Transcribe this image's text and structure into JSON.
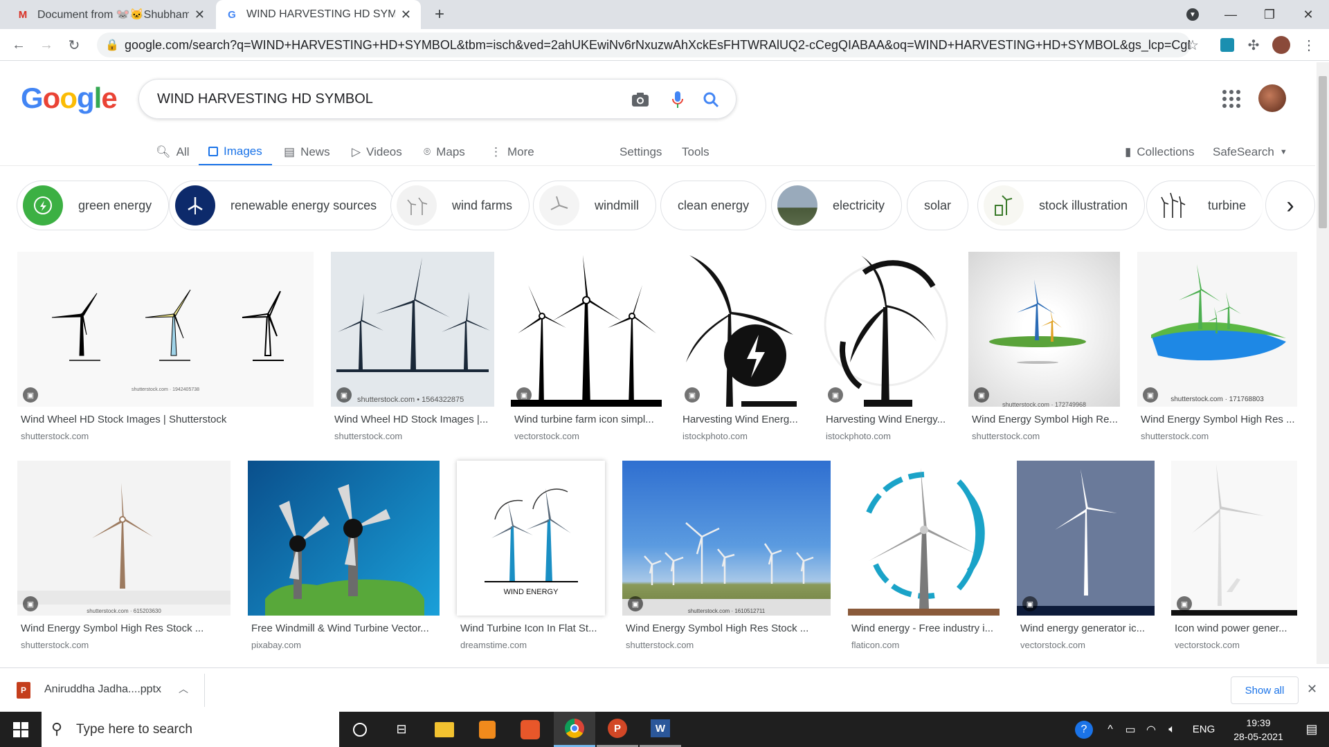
{
  "browser": {
    "tabs": [
      {
        "favicon": "gmail-icon",
        "title": "Document from 🐭🐱Shubham🧍"
      },
      {
        "favicon": "google-icon",
        "title": "WIND HARVESTING HD SYMBOL"
      }
    ],
    "url": "google.com/search?q=WIND+HARVESTING+HD+SYMBOL&tbm=isch&ved=2ahUKEwiNv6rNxuzwAhXckEsFHTWRAlUQ2-cCegQIABAA&oq=WIND+HARVESTING+HD+SYMBOL&gs_lcp=CgNpbW..."
  },
  "google": {
    "logo": "Google",
    "query": "WIND HARVESTING HD SYMBOL",
    "tabs": [
      "All",
      "Images",
      "News",
      "Videos",
      "Maps",
      "More"
    ],
    "settings": "Settings",
    "tools": "Tools",
    "collections": "Collections",
    "safesearch": "SafeSearch"
  },
  "chips": [
    "green energy",
    "renewable energy sources",
    "wind farms",
    "windmill",
    "clean energy",
    "electricity",
    "solar",
    "stock illustration",
    "turbine"
  ],
  "results": [
    {
      "caption": "Wind Wheel HD Stock Images | Shutterstock",
      "source": "shutterstock.com",
      "watermark": "shutterstock.com · 1942405738"
    },
    {
      "caption": "Wind Wheel HD Stock Images |...",
      "source": "shutterstock.com",
      "watermark": "shutterstock.com • 1564322875"
    },
    {
      "caption": "Wind turbine farm icon simpl...",
      "source": "vectorstock.com",
      "watermark": ""
    },
    {
      "caption": "Harvesting Wind Energ...",
      "source": "istockphoto.com",
      "watermark": ""
    },
    {
      "caption": "Harvesting Wind Energy...",
      "source": "istockphoto.com",
      "watermark": ""
    },
    {
      "caption": "Wind Energy Symbol High Re...",
      "source": "shutterstock.com",
      "watermark": "shutterstock.com · 172749968"
    },
    {
      "caption": "Wind Energy Symbol High Res ...",
      "source": "shutterstock.com",
      "watermark": "shutterstock.com · 171768803"
    },
    {
      "caption": "Wind Energy Symbol High Res Stock ...",
      "source": "shutterstock.com",
      "watermark": "shutterstock.com · 615203630"
    },
    {
      "caption": "Free Windmill & Wind Turbine Vector...",
      "source": "pixabay.com",
      "watermark": ""
    },
    {
      "caption": "Wind Turbine Icon In Flat St...",
      "source": "dreamstime.com",
      "watermark": "WIND ENERGY"
    },
    {
      "caption": "Wind Energy Symbol High Res Stock ...",
      "source": "shutterstock.com",
      "watermark": "shutterstock.com · 1610512711"
    },
    {
      "caption": "Wind energy - Free industry i...",
      "source": "flaticon.com",
      "watermark": ""
    },
    {
      "caption": "Wind energy generator ic...",
      "source": "vectorstock.com",
      "watermark": ""
    },
    {
      "caption": "Icon wind power gener...",
      "source": "vectorstock.com",
      "watermark": ""
    }
  ],
  "downloads": {
    "file": "Aniruddha Jadha....pptx",
    "show_all": "Show all"
  },
  "taskbar": {
    "search_placeholder": "Type here to search",
    "lang": "ENG",
    "time": "19:39",
    "date": "28-05-2021"
  }
}
